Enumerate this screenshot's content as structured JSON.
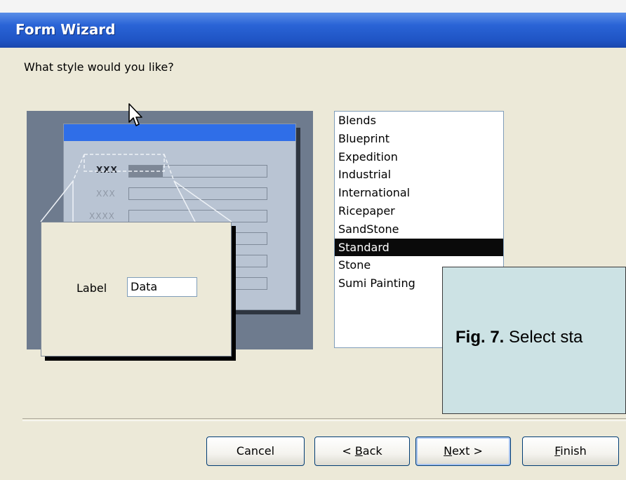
{
  "window": {
    "title": "Form Wizard"
  },
  "prompt": "What style would you like?",
  "preview": {
    "back_labels": [
      "XXX",
      "XXX",
      "XXXX"
    ],
    "front_label": "Label",
    "front_value": "Data"
  },
  "styles": {
    "items": [
      "Blends",
      "Blueprint",
      "Expedition",
      "Industrial",
      "International",
      "Ricepaper",
      "SandStone",
      "Standard",
      "Stone",
      "Sumi Painting"
    ],
    "selected": "Standard"
  },
  "caption": {
    "fig": "Fig. 7.",
    "text": " Select sta"
  },
  "buttons": {
    "cancel": "Cancel",
    "back_prefix": "< ",
    "back_mnemonic": "B",
    "back_rest": "ack",
    "next_mnemonic": "N",
    "next_rest": "ext >",
    "finish_mnemonic": "F",
    "finish_rest": "inish"
  },
  "colors": {
    "titlebar": "#2a64d6",
    "dialog_bg": "#ece9d8",
    "selection_bg": "#0a0a0a",
    "caption_bg": "#cce2e4"
  }
}
